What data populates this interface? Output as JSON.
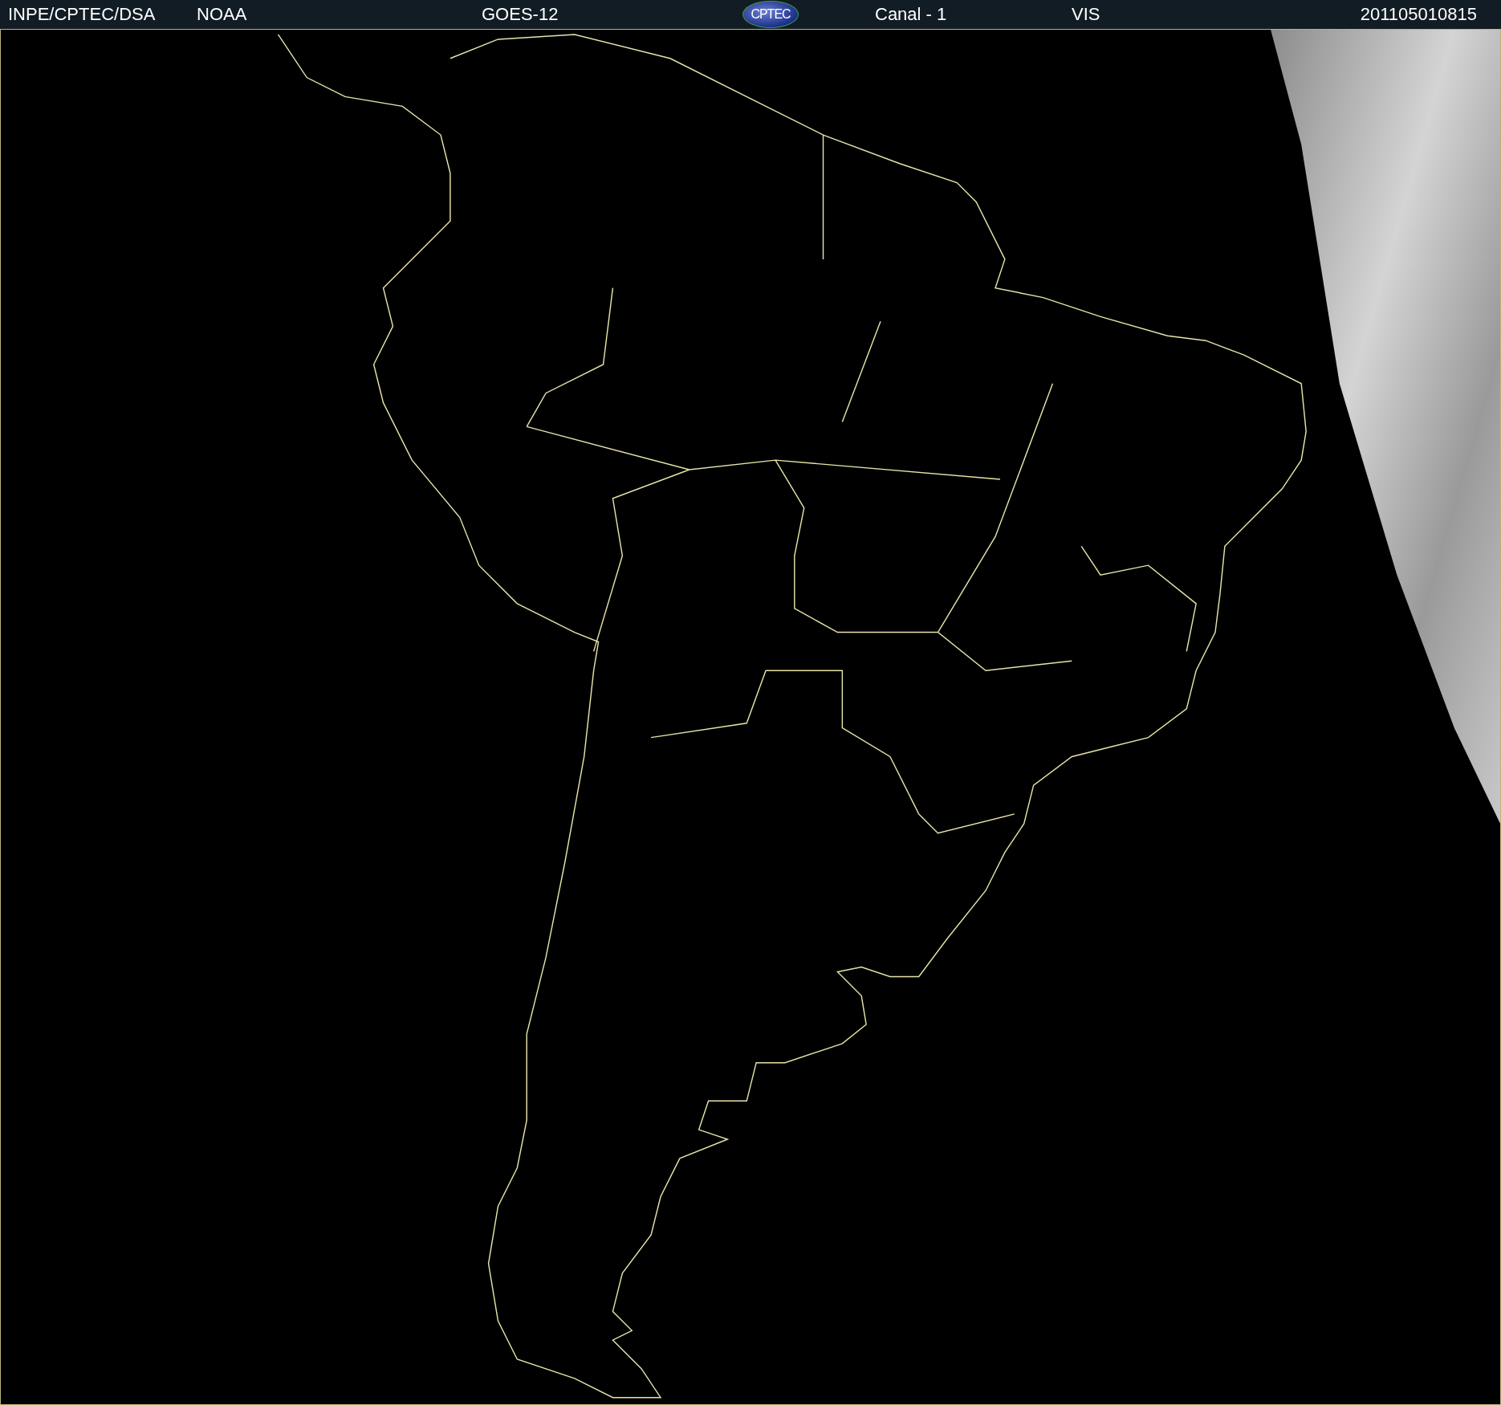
{
  "header": {
    "items": [
      {
        "kind": "text",
        "text": "INPE/CPTEC/DSA"
      },
      {
        "kind": "text",
        "text": "NOAA"
      },
      {
        "kind": "text",
        "text": "GOES-12"
      },
      {
        "kind": "logo",
        "text": "CPTEC"
      },
      {
        "kind": "text",
        "text": "Canal - 1"
      },
      {
        "kind": "text",
        "text": "VIS"
      },
      {
        "kind": "text",
        "text": "201105010815"
      }
    ]
  }
}
